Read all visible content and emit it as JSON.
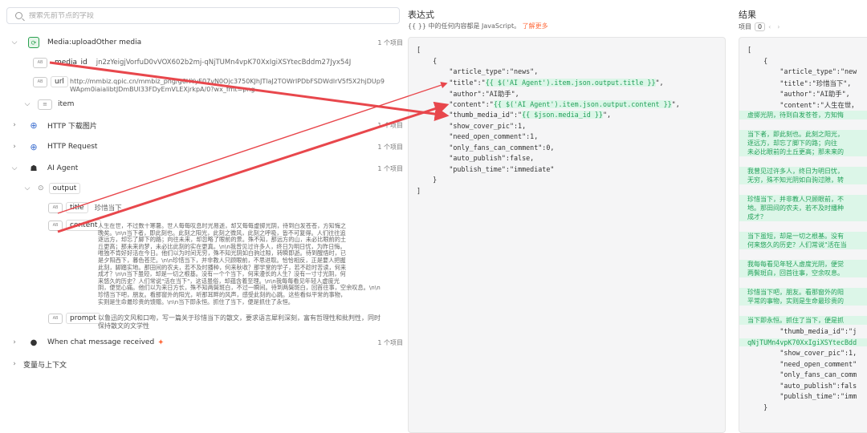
{
  "search": {
    "placeholder": "搜索先前节点的字段"
  },
  "tree": {
    "media_upload": {
      "title": "Media:uploadOther media",
      "count": "1 个项目"
    },
    "media_id": {
      "key": "media_id",
      "value": "jn2zYeigjVorfuD0vVOX602b2mj-qNjTUMn4vpK70XxIgiXSYtecBddm27Jyx54J"
    },
    "url": {
      "key": "url",
      "value_line1": "http://mmbiz.qpic.cn/mmbiz_png/g6HYyF07vN0Ojc3750KJhJTlaJ2TOWrIPDbFSDWdlrV5f5X2hjDUp9",
      "value_line2": "WApm0iaialibtJDmBUI33FDyEmVLEXjrkpA/0?wx_fmt=png"
    },
    "item": {
      "label": "item"
    },
    "http_download": {
      "title": "HTTP 下载图片",
      "count": "1 个项目"
    },
    "http_request": {
      "title": "HTTP Request",
      "count": "1 个项目"
    },
    "ai_agent": {
      "title": "AI Agent",
      "count": "1 个项目"
    },
    "output": {
      "label": "output"
    },
    "title_field": {
      "key": "title",
      "value": "珍惜当下"
    },
    "content_field": {
      "key": "content",
      "lines": [
        "人生在世，不过数十寒暑。世人每每叹息时光易逝，却又每每虚掷光阴，待到白发苍苍，方知悔之",
        "晚矣。\\n\\n当下者，即此刻也。此刻之阳光，此刻之微风，此刻之呼吸，皆不可复得。人们往往追",
        "逐远方，却忘了脚下的路；向往未来，却忽略了眼前的景。殊不知，那远方的山，未必比眼前的土",
        "丘更高；那未来的梦，未必比此刻的实在更真。\\n\\n我曾见过许多人，终日为明日忧，为昨日悔。",
        "唯独不肯好好活在今日。他们以为时间无穷，殊不知光阴如白驹过隙，转瞬即逝。待到醒悟时，已",
        "是夕阳西下，暮色苍茫。\\n\\n珍惜当下，并非教人只顾眼前，不思进取。恰恰相反，正是要人把握",
        "此刻，脚踏实地。那田间的农夫，若不及时播种，何来秋收？那学堂的学子，若不趁时苦读，何来",
        "成才？\\n\\n当下虽短，却是一切之根基。没有一个个当下，何来漫长的人生？没有一寸寸光阴，何",
        "来悠久的历史？人们常说\"活在当下\"，这话虽俗，却蕴含着至理。\\n\\n我每每看见年轻人虚度光",
        "阴，便觉心痛。他们以为来日方长，殊不知两鬓斑白，不过一瞬间。待到两鬓斑白，回首往事，空余叹息。\\n\\n",
        "珍惜当下吧，朋友。看那窗外的阳光，听那耳畔的风声，感受此刻的心跳。这些看似平常的事物，",
        "实则是生命最珍贵的馈赠。\\n\\n当下即永恒。抓住了当下，便是抓住了永恒。"
      ]
    },
    "prompt_field": {
      "key": "prompt",
      "line1": "以鲁迅的文风和口吻，写一篇关于珍惜当下的散文，要求语言犀利深刻，富有哲理性和批判性，同时",
      "line2": "保持散文的文学性"
    },
    "chat_trigger": {
      "title": "When chat message received",
      "count": "1 个项目"
    },
    "vars": {
      "title": "变量与上下文"
    }
  },
  "expression": {
    "title": "表达式",
    "subtitle": "{{ }} 中的任何内容都是 JavaScript。",
    "learn_more": "了解更多",
    "lines": [
      {
        "text": "["
      },
      {
        "text": "    {"
      },
      {
        "pre": "        \"article_type\":\"news\","
      },
      {
        "pre": "        \"title\":\"",
        "hl": "{{ $('AI Agent').item.json.output.title }}",
        "post": "\","
      },
      {
        "pre": "        \"author\":\"AI助手\","
      },
      {
        "pre": "        \"content\":\"",
        "hl": "{{ $('AI Agent').item.json.output.content }}",
        "post": "\","
      },
      {
        "pre": "        \"thumb_media_id\":\"",
        "hl": "{{ $json.media_id }}",
        "post": "\","
      },
      {
        "pre": "        \"show_cover_pic\":1,"
      },
      {
        "pre": "        \"need_open_comment\":1,"
      },
      {
        "pre": "        \"only_fans_can_comment\":0,"
      },
      {
        "pre": "        \"auto_publish\":false,"
      },
      {
        "pre": "        \"publish_time\":\"immediate\""
      },
      {
        "text": "    }"
      },
      {
        "text": "]"
      }
    ]
  },
  "result": {
    "title": "结果",
    "meta_label": "项目",
    "item_index": "0",
    "top_lines": [
      "[",
      "    {",
      "        \"article_type\":\"new",
      "        \"title\":\"珍惜当下\",",
      "        \"author\":\"AI助手\",",
      "        \"content\":\"人生在世，"
    ],
    "green_blocks": [
      [
        "虚掷光阴，待到白发苍苍，方知悔"
      ],
      [
        "当下者，即此刻也。此刻之阳光，",
        "逐远方，却忘了脚下的路；向往",
        "未必比眼前的土丘更高；那未来的"
      ],
      [
        "我曾见过许多人，终日为明日忧，",
        "无穷，殊不知光阴如白驹过隙，转"
      ],
      [
        "珍惜当下，并非教人只顾眼前，不",
        "地。那田间的农夫，若不及时播种",
        "成才？"
      ],
      [
        "当下虽短，却是一切之根基。没有",
        "何来悠久的历史？人们常说\"活在当"
      ],
      [
        "我每每看见年轻人虚度光阴，便觉",
        "两鬓斑白，回首往事，空余叹息。"
      ],
      [
        "珍惜当下吧，朋友。看那窗外的阳",
        "平常的事物，实则是生命最珍贵的"
      ],
      [
        "当下即永恒。抓住了当下，便是抓"
      ]
    ],
    "bottom_lines": [
      "        \"thumb_media_id\":\"j",
      "qNjTUMn4vpK70XxIgiXSYtecBdd",
      "        \"show_cover_pic\":1,",
      "        \"need_open_comment\"",
      "        \"only_fans_can_comm",
      "        \"auto_publish\":fals",
      "        \"publish_time\":\"imm",
      "    }"
    ]
  },
  "colors": {
    "accent": "#ff6b3d",
    "arrow": "#e8474c",
    "highlight_bg": "#dcf6e8",
    "highlight_fg": "#23a15a"
  }
}
